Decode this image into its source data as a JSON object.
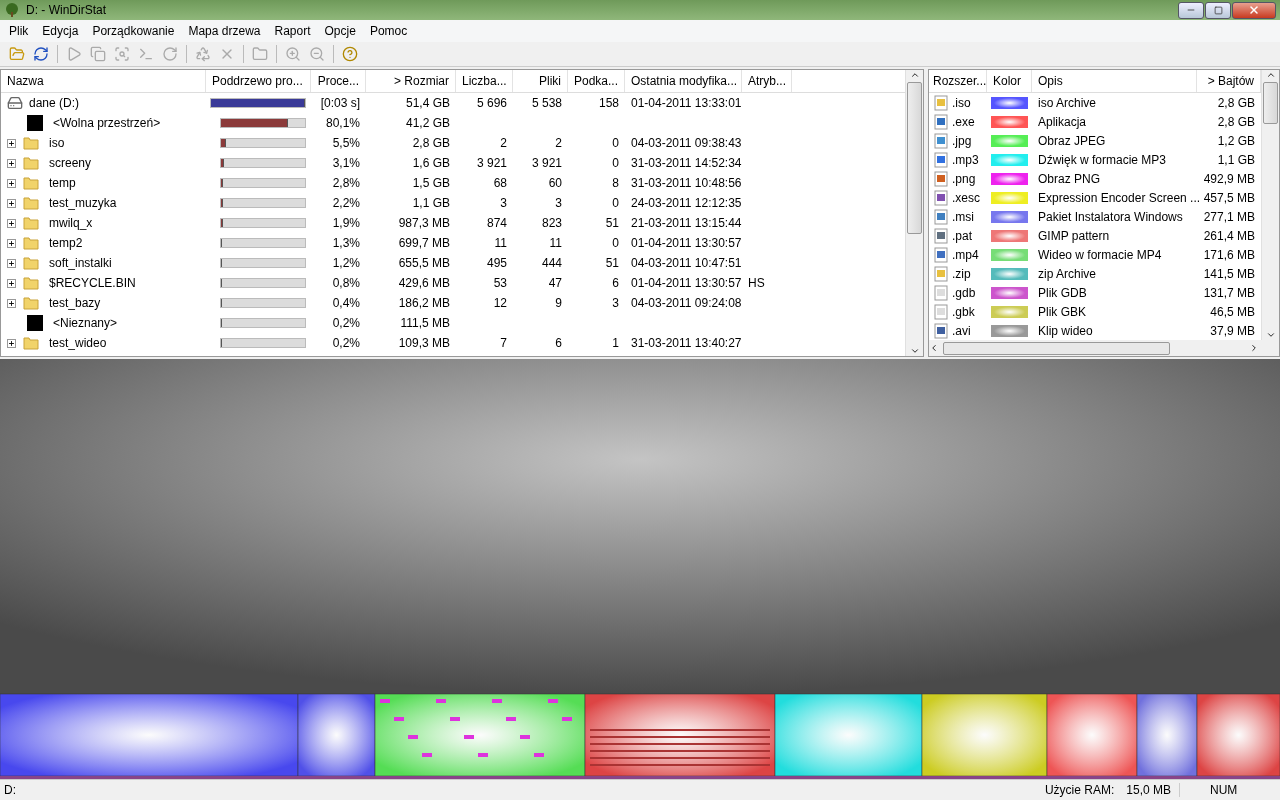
{
  "window": {
    "title": "D: - WinDirStat"
  },
  "menu": [
    "Plik",
    "Edycja",
    "Porządkowanie",
    "Mapa drzewa",
    "Raport",
    "Opcje",
    "Pomoc"
  ],
  "toolbar": [
    {
      "kind": "open",
      "disabled": false
    },
    {
      "kind": "refresh",
      "disabled": false
    },
    {
      "kind": "sep"
    },
    {
      "kind": "play",
      "disabled": true
    },
    {
      "kind": "copy",
      "disabled": true
    },
    {
      "kind": "explore",
      "disabled": true
    },
    {
      "kind": "terminal",
      "disabled": true
    },
    {
      "kind": "reload",
      "disabled": true
    },
    {
      "kind": "sep"
    },
    {
      "kind": "recycle",
      "disabled": true
    },
    {
      "kind": "delete",
      "disabled": true
    },
    {
      "kind": "sep"
    },
    {
      "kind": "folder",
      "disabled": true
    },
    {
      "kind": "sep"
    },
    {
      "kind": "zoomin",
      "disabled": true
    },
    {
      "kind": "zoomout",
      "disabled": true
    },
    {
      "kind": "sep"
    },
    {
      "kind": "help",
      "disabled": false
    }
  ],
  "tree": {
    "columns": [
      "Nazwa",
      "Poddrzewo pro...",
      "Proce...",
      "> Rozmiar",
      "Liczba...",
      "Pliki",
      "Podka...",
      "Ostatnia modyfika...",
      "Atryb..."
    ],
    "root": {
      "kind": "drive",
      "name": "dane (D:)",
      "level": 1,
      "percent": "[0:03 s]",
      "size": "51,4 GB",
      "items": "5 696",
      "files": "5 538",
      "subdirs": "158",
      "modified": "01-04-2011  13:33:01",
      "children": [
        {
          "kind": "special",
          "name": "<Wolna przestrzeń>",
          "level": 0.8,
          "percent": "80,1%",
          "size": "41,2 GB"
        },
        {
          "kind": "folder",
          "name": "iso",
          "expanded": false,
          "level": 0.055,
          "percent": "5,5%",
          "size": "2,8 GB",
          "items": "2",
          "files": "2",
          "subdirs": "0",
          "modified": "04-03-2011  09:38:43"
        },
        {
          "kind": "folder",
          "name": "screeny",
          "expanded": false,
          "level": 0.031,
          "percent": "3,1%",
          "size": "1,6 GB",
          "items": "3 921",
          "files": "3 921",
          "subdirs": "0",
          "modified": "31-03-2011  14:52:34"
        },
        {
          "kind": "folder",
          "name": "temp",
          "expanded": false,
          "level": 0.028,
          "percent": "2,8%",
          "size": "1,5 GB",
          "items": "68",
          "files": "60",
          "subdirs": "8",
          "modified": "31-03-2011  10:48:56"
        },
        {
          "kind": "folder",
          "name": "test_muzyka",
          "expanded": false,
          "level": 0.022,
          "percent": "2,2%",
          "size": "1,1 GB",
          "items": "3",
          "files": "3",
          "subdirs": "0",
          "modified": "24-03-2011  12:12:35"
        },
        {
          "kind": "folder",
          "name": "mwilq_x",
          "expanded": false,
          "level": 0.019,
          "percent": "1,9%",
          "size": "987,3 MB",
          "items": "874",
          "files": "823",
          "subdirs": "51",
          "modified": "21-03-2011  13:15:44"
        },
        {
          "kind": "folder",
          "name": "temp2",
          "expanded": false,
          "level": 0.013,
          "percent": "1,3%",
          "size": "699,7 MB",
          "items": "11",
          "files": "11",
          "subdirs": "0",
          "modified": "01-04-2011  13:30:57"
        },
        {
          "kind": "folder",
          "name": "soft_instalki",
          "expanded": false,
          "level": 0.012,
          "percent": "1,2%",
          "size": "655,5 MB",
          "items": "495",
          "files": "444",
          "subdirs": "51",
          "modified": "04-03-2011  10:47:51"
        },
        {
          "kind": "folder",
          "name": "$RECYCLE.BIN",
          "expanded": false,
          "level": 0.008,
          "percent": "0,8%",
          "size": "429,6 MB",
          "items": "53",
          "files": "47",
          "subdirs": "6",
          "modified": "01-04-2011  13:30:57",
          "attributes": "HS"
        },
        {
          "kind": "folder",
          "name": "test_bazy",
          "expanded": false,
          "level": 0.004,
          "percent": "0,4%",
          "size": "186,2 MB",
          "items": "12",
          "files": "9",
          "subdirs": "3",
          "modified": "04-03-2011  09:24:08"
        },
        {
          "kind": "special",
          "name": "<Nieznany>",
          "level": 0.002,
          "percent": "0,2%",
          "size": "111,5 MB"
        },
        {
          "kind": "folder",
          "name": "test_wideo",
          "expanded": false,
          "level": 0.002,
          "percent": "0,2%",
          "size": "109,3 MB",
          "items": "7",
          "files": "6",
          "subdirs": "1",
          "modified": "31-03-2011  13:40:27"
        }
      ]
    }
  },
  "extensions": {
    "columns": [
      "Rozszer...",
      "Kolor",
      "Opis",
      "> Bajtów"
    ],
    "rows": [
      {
        "ext": ".iso",
        "color": "#5555ff",
        "description": "iso Archive",
        "bytes": "2,8 GB"
      },
      {
        "ext": ".exe",
        "color": "#ff5555",
        "description": "Aplikacja",
        "bytes": "2,8 GB"
      },
      {
        "ext": ".jpg",
        "color": "#55ee55",
        "description": "Obraz JPEG",
        "bytes": "1,2 GB"
      },
      {
        "ext": ".mp3",
        "color": "#22eeee",
        "description": "Dźwięk w formacie MP3",
        "bytes": "1,1 GB"
      },
      {
        "ext": ".png",
        "color": "#ee22ee",
        "description": "Obraz PNG",
        "bytes": "492,9 MB"
      },
      {
        "ext": ".xesc",
        "color": "#eeee22",
        "description": "Expression Encoder Screen ...",
        "bytes": "457,5 MB"
      },
      {
        "ext": ".msi",
        "color": "#7777ee",
        "description": "Pakiet Instalatora Windows",
        "bytes": "277,1 MB"
      },
      {
        "ext": ".pat",
        "color": "#ee7777",
        "description": "GIMP pattern",
        "bytes": "261,4 MB"
      },
      {
        "ext": ".mp4",
        "color": "#77dd77",
        "description": "Wideo w formacie MP4",
        "bytes": "171,6 MB"
      },
      {
        "ext": ".zip",
        "color": "#55bbbb",
        "description": "zip Archive",
        "bytes": "141,5 MB"
      },
      {
        "ext": ".gdb",
        "color": "#cc55cc",
        "description": "Plik GDB",
        "bytes": "131,7 MB"
      },
      {
        "ext": ".gbk",
        "color": "#cccc55",
        "description": "Plik GBK",
        "bytes": "46,5 MB"
      },
      {
        "ext": ".avi",
        "color": "#999999",
        "description": "Klip wideo",
        "bytes": "37,9 MB"
      }
    ]
  },
  "status_bar": {
    "path": "D:",
    "ram_label": "Użycie RAM:",
    "ram_value": "15,0 MB",
    "num": "NUM"
  }
}
